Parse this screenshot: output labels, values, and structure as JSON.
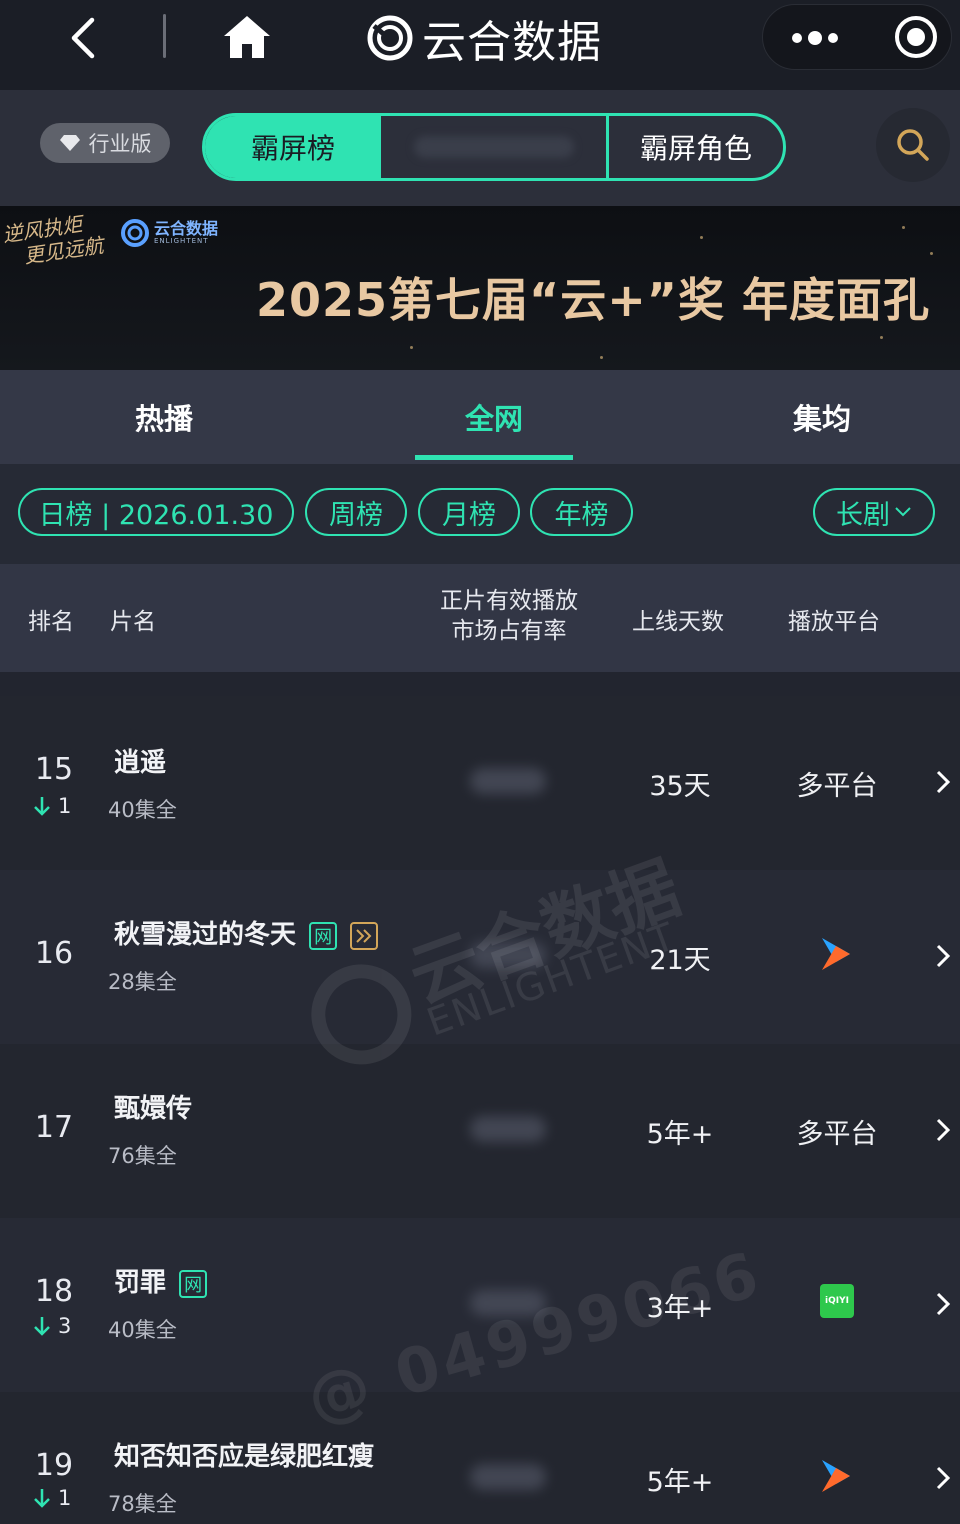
{
  "app": {
    "title": "云合数据",
    "icons": {
      "back": "chevron-left-icon",
      "home": "home-icon",
      "logo": "yunhe-logo-icon",
      "more": "more-dots-icon",
      "target": "target-icon",
      "search": "search-icon"
    }
  },
  "toolbar": {
    "edition_label": "行业版",
    "segments": [
      {
        "label": "霸屏榜",
        "active": true
      },
      {
        "label": "",
        "active": false
      },
      {
        "label": "霸屏角色",
        "active": false
      }
    ]
  },
  "banner": {
    "slogan_line1": "逆风执炬",
    "slogan_line2": "更见远航",
    "logo_text": "云合数据",
    "logo_sub": "ENLIGHTENT",
    "headline": "2025第七届“云+”奖  年度面孔"
  },
  "tabs": [
    {
      "label": "热播",
      "active": false
    },
    {
      "label": "全网",
      "active": true
    },
    {
      "label": "集均",
      "active": false
    }
  ],
  "periods": {
    "daily": "日榜 | 2026.01.30",
    "weekly": "周榜",
    "monthly": "月榜",
    "yearly": "年榜",
    "genre": "长剧"
  },
  "table": {
    "columns": {
      "rank": "排名",
      "title": "片名",
      "share_line1": "正片有效播放",
      "share_line2": "市场占有率",
      "days": "上线天数",
      "platform": "播放平台"
    },
    "rows": [
      {
        "rank": "15",
        "change": "1",
        "title": "逍遥",
        "episodes": "40集全",
        "days": "35天",
        "platform": "多平台",
        "badges": []
      },
      {
        "rank": "16",
        "change": "",
        "title": "秋雪漫过的冬天",
        "episodes": "28集全",
        "days": "21天",
        "platform": "",
        "platform_icon": "youku-icon",
        "badges": [
          "网",
          "play-badge-icon"
        ]
      },
      {
        "rank": "17",
        "change": "",
        "title": "甄嬛传",
        "episodes": "76集全",
        "days": "5年+",
        "platform": "多平台",
        "badges": []
      },
      {
        "rank": "18",
        "change": "3",
        "title": "罚罪",
        "episodes": "40集全",
        "days": "3年+",
        "platform": "",
        "platform_icon": "iqiyi-icon",
        "platform_icon_text": "iQIYI",
        "badges": [
          "网"
        ]
      },
      {
        "rank": "19",
        "change": "1",
        "title": "知否知否应是绿肥红瘦",
        "episodes": "78集全",
        "days": "5年+",
        "platform": "",
        "platform_icon": "youku-icon",
        "badges": []
      }
    ]
  },
  "watermark": {
    "brand": "云合数据",
    "brand_sub": "ENLIGHTENT",
    "user_id": "@ 04999066"
  },
  "colors": {
    "accent": "#2fe3b2",
    "background": "#22252f",
    "badge_gold": "#d3a659",
    "iqiyi_green": "#2ec84c"
  }
}
